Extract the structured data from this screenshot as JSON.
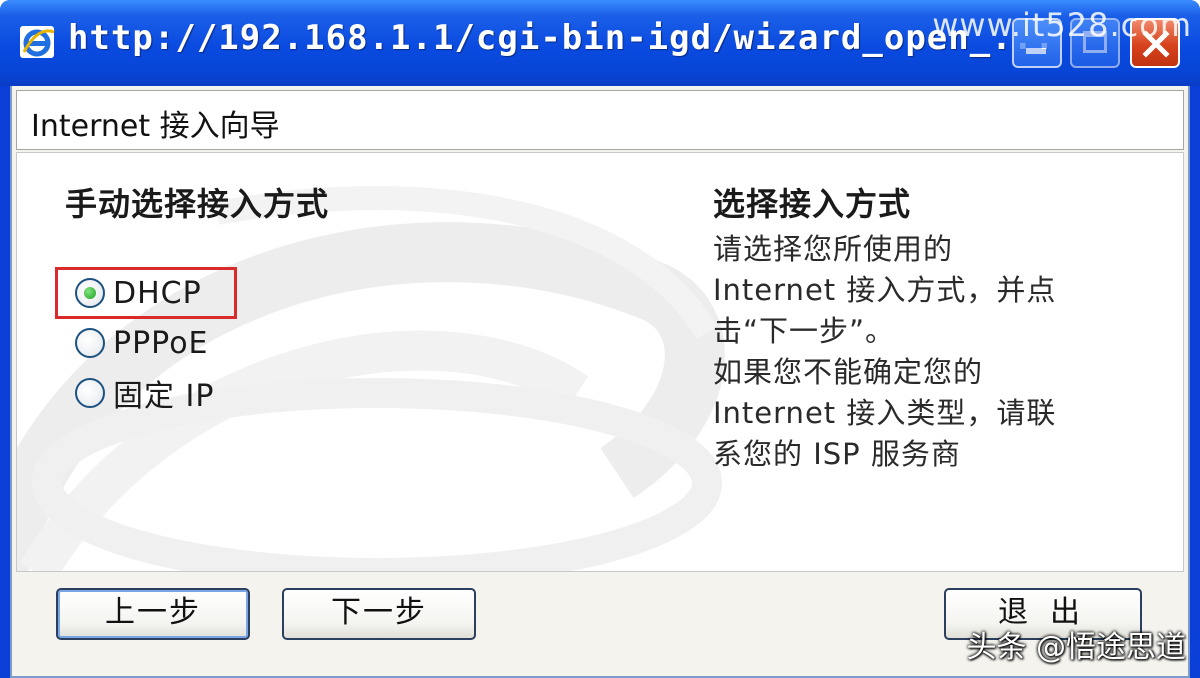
{
  "window": {
    "title": "http://192.168.1.1/cgi-bin-igd/wizard_open_...",
    "icon": "ie-icon"
  },
  "watermarks": {
    "top_right": "www.it528.com",
    "bottom_right": "头条 @悟途思道"
  },
  "header": {
    "title": "Internet 接入向导"
  },
  "left_panel": {
    "heading": "手动选择接入方式",
    "options": [
      {
        "label": "DHCP",
        "checked": true
      },
      {
        "label": "PPPoE",
        "checked": false
      },
      {
        "label": "固定 IP",
        "checked": false
      }
    ]
  },
  "right_panel": {
    "heading": "选择接入方式",
    "lines": [
      "请选择您所使用的",
      "Internet 接入方式，并点",
      "击“下一步”。",
      "如果您不能确定您的",
      "Internet 接入类型，请联",
      "系您的 ISP 服务商"
    ]
  },
  "buttons": {
    "prev": "上一步",
    "next": "下一步",
    "exit": "退出"
  },
  "colors": {
    "titlebar": "#0a4ae0",
    "highlight": "#d92b2b",
    "close_button": "#d6421c"
  }
}
